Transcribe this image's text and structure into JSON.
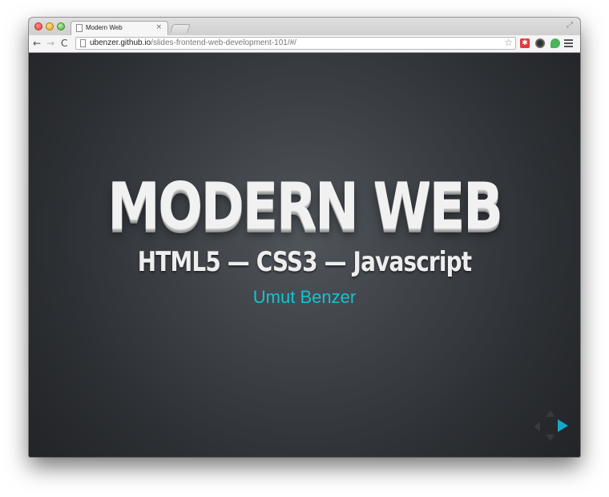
{
  "browser": {
    "tab": {
      "title": "Modern Web",
      "close_glyph": "×"
    },
    "toolbar": {
      "back_glyph": "←",
      "forward_glyph": "→",
      "reload_glyph": "C",
      "url_host": "ubenzer.github.io",
      "url_path": "/slides-frontend-web-development-101/#/",
      "star_glyph": "☆",
      "extension_1_glyph": "✱"
    },
    "fullscreen_glyph": "⤢"
  },
  "slide": {
    "title": "MODERN WEB",
    "subtitle": "HTML5 — CSS3 — Javascript",
    "author": "Umut Benzer"
  },
  "colors": {
    "accent": "#15c1d4",
    "background": "#3e4247",
    "nav_active": "#13a8c4"
  },
  "icons": {
    "traffic_lights": [
      "close-icon",
      "minimize-icon",
      "maximize-icon"
    ],
    "extensions": [
      "red-extension-icon",
      "dark-circle-extension-icon",
      "green-extension-icon"
    ],
    "menu": "hamburger-menu-icon",
    "slide_nav": [
      "nav-up-icon",
      "nav-down-icon",
      "nav-left-icon",
      "nav-right-icon"
    ]
  }
}
